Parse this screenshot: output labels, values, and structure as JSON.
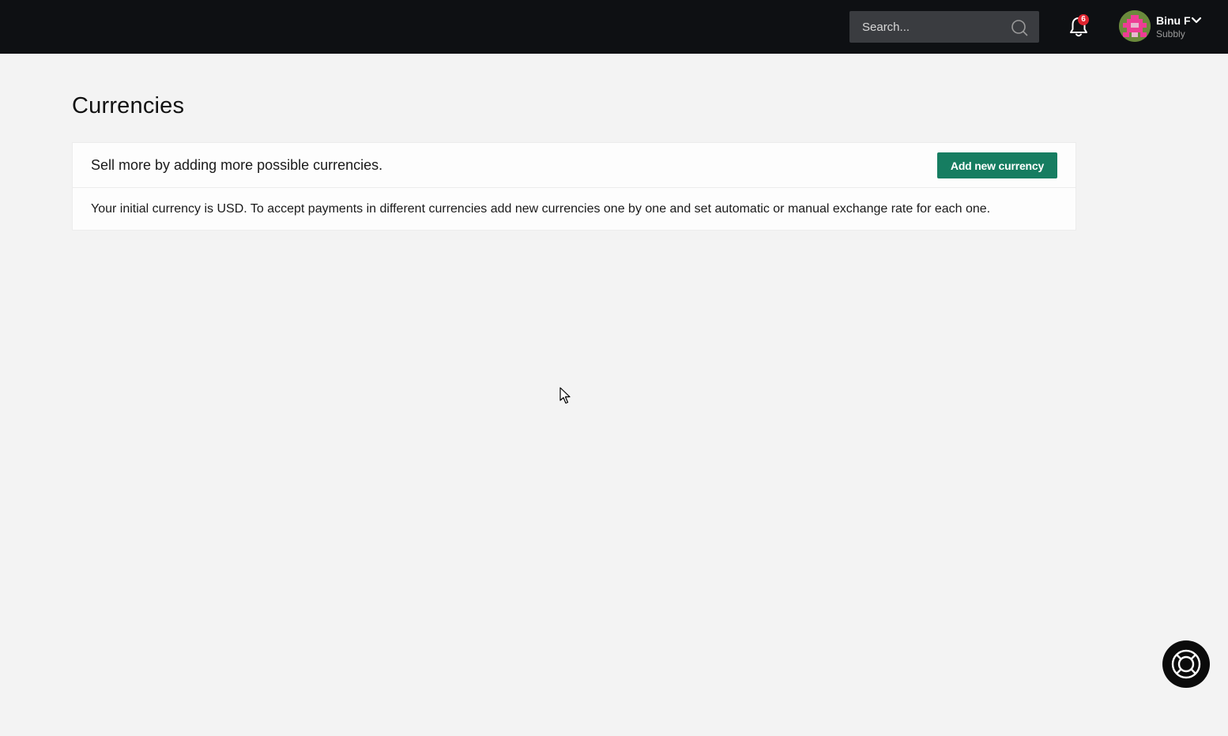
{
  "header": {
    "search": {
      "placeholder": "Search...",
      "value": ""
    },
    "notifications": {
      "count": "6"
    },
    "user": {
      "name": "Binu F",
      "organization": "Subbly"
    }
  },
  "page": {
    "title": "Currencies"
  },
  "card": {
    "subtitle": "Sell more by adding more possible currencies.",
    "add_button_label": "Add new currency",
    "description": "Your initial currency is USD. To accept payments in different currencies add new currencies one by one and set automatic or manual exchange rate for each one."
  },
  "colors": {
    "topbar": "#0e1013",
    "accent": "#167d61",
    "badge": "#e0242f",
    "background": "#f3f3f3"
  },
  "icons": [
    "search-icon",
    "bell-icon",
    "chevron-down-icon",
    "lifebuoy-icon",
    "mouse-cursor"
  ]
}
